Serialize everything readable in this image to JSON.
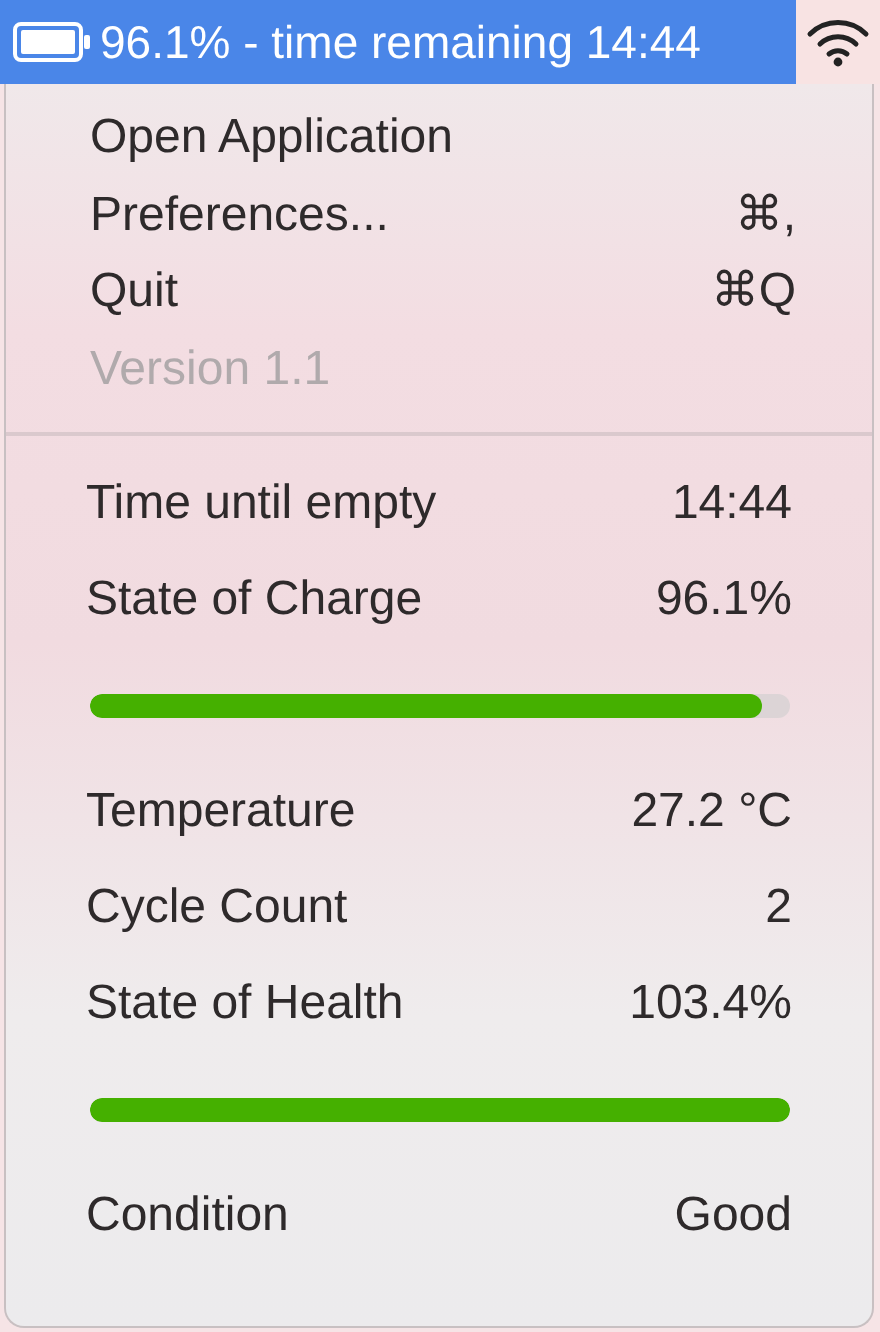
{
  "menu_bar": {
    "status_text": "96.1% - time remaining 14:44",
    "selected": true
  },
  "menu_items": [
    {
      "label": "Open Application",
      "disabled": false
    },
    {
      "label": "Preferences...",
      "shortcut": "⌘,",
      "disabled": false
    },
    {
      "label": "Quit",
      "shortcut": "⌘Q",
      "disabled": false
    },
    {
      "label": "Version 1.1",
      "disabled": true
    }
  ],
  "stats": [
    {
      "kind": "row",
      "label": "Time until empty",
      "value": "14:44"
    },
    {
      "kind": "row",
      "label": "State of Charge",
      "value": "96.1%"
    },
    {
      "kind": "bar",
      "level": 0.961
    },
    {
      "kind": "row",
      "label": "Temperature",
      "value": "27.2 °C"
    },
    {
      "kind": "row",
      "label": "Cycle Count",
      "value": "2"
    },
    {
      "kind": "row",
      "label": "State of Health",
      "value": "103.4%"
    },
    {
      "kind": "bar",
      "level": 1
    },
    {
      "kind": "row",
      "label": "Condition",
      "value": "Good"
    }
  ]
}
